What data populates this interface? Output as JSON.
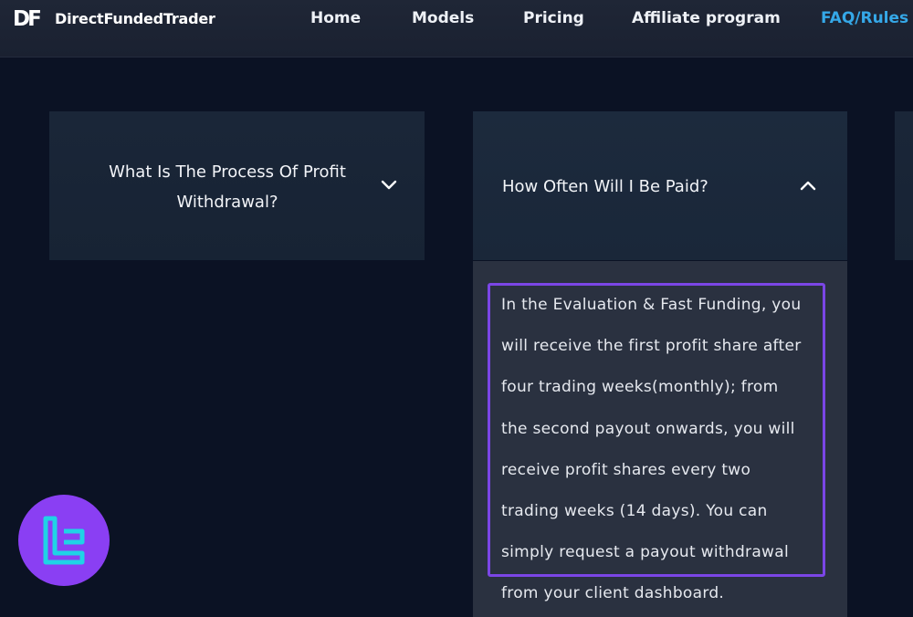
{
  "header": {
    "logo_mark": "DF",
    "brand": "DirectFundedTrader",
    "nav": [
      {
        "label": "Home",
        "active": false
      },
      {
        "label": "Models",
        "active": false
      },
      {
        "label": "Pricing",
        "active": false
      },
      {
        "label": "Affiliate program",
        "active": false
      },
      {
        "label": "FAQ/Rules",
        "active": true
      }
    ]
  },
  "faq": {
    "items": [
      {
        "question": "What Is The Process Of Profit Withdrawal?",
        "question_lines": [
          "What Is The Process Of Profit",
          "Withdrawal?"
        ],
        "expanded": false,
        "icon": "chevron-down-icon"
      },
      {
        "question": "How Often Will I Be Paid?",
        "expanded": true,
        "icon": "chevron-up-icon",
        "answer_lines": [
          "In the Evaluation & Fast Funding, you",
          "will receive the first profit share after",
          "four trading weeks(monthly); from",
          "the second payout onwards, you will",
          "receive profit shares every two",
          "trading weeks (14 days). You can",
          "simply request a payout withdrawal",
          "from your client dashboard."
        ]
      }
    ]
  },
  "colors": {
    "background": "#0b1224",
    "header": "#1c2333",
    "card": "#1a2638",
    "answer_panel": "#2a3140",
    "highlight": "#7b46e6",
    "active_nav": "#35a8e8",
    "badge": "#8a3ff3"
  },
  "watermark": {
    "icon": "tradingfinder-logo-icon"
  }
}
